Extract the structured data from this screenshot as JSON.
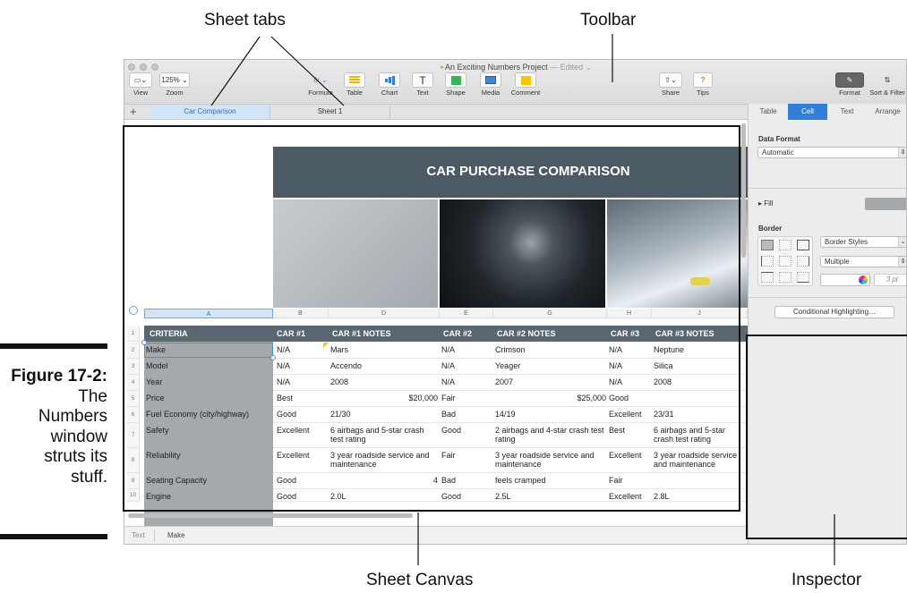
{
  "callouts": {
    "sheet_tabs": "Sheet tabs",
    "toolbar": "Toolbar",
    "sheet_canvas": "Sheet Canvas",
    "inspector": "Inspector"
  },
  "figure": {
    "number": "Figure 17-2:",
    "caption_lines": [
      "The",
      "Numbers",
      "window",
      "struts its",
      "stuff."
    ]
  },
  "window": {
    "title": "An Exciting Numbers Project",
    "edited": "— Edited ⌄"
  },
  "toolbar": {
    "view": "View",
    "zoom_value": "125% ⌄",
    "zoom": "Zoom",
    "formula": "Formula",
    "formula_icon": "fx ⌄",
    "table": "Table",
    "chart": "Chart",
    "text": "Text",
    "text_icon": "T",
    "shape": "Shape",
    "media": "Media",
    "comment": "Comment",
    "share": "Share",
    "tips": "Tips",
    "tips_icon": "?",
    "format": "Format",
    "sort_filter": "Sort & Filter"
  },
  "sheets": {
    "add": "+",
    "tabs": [
      "Car Comparison",
      "Sheet 1"
    ]
  },
  "inspector": {
    "tabs": [
      "Table",
      "Cell",
      "Text",
      "Arrange"
    ],
    "data_format_label": "Data Format",
    "data_format_value": "Automatic",
    "fill_label": "▸ Fill",
    "border_label": "Border",
    "border_styles": "Border Styles",
    "border_multiple": "Multiple",
    "border_width": "3 pt",
    "conditional_highlighting": "Conditional Highlighting…"
  },
  "status": {
    "format": "Text",
    "value": "Make"
  },
  "sheet": {
    "title": "CAR PURCHASE COMPARISON",
    "col_letters": [
      "A",
      "B",
      "D",
      "E",
      "G",
      "H",
      "J"
    ],
    "headers": [
      "CRITERIA",
      "CAR #1",
      "CAR #1 NOTES",
      "CAR #2",
      "CAR #2 NOTES",
      "CAR #3",
      "CAR #3 NOTES"
    ],
    "rows": [
      {
        "n": "2",
        "cells": [
          "Make",
          "N/A",
          "Mars",
          "N/A",
          "Crimson",
          "N/A",
          "Neptune"
        ]
      },
      {
        "n": "3",
        "cells": [
          "Model",
          "N/A",
          "Accendo",
          "N/A",
          "Yeager",
          "N/A",
          "Silica"
        ]
      },
      {
        "n": "4",
        "cells": [
          "Year",
          "N/A",
          "2008",
          "N/A",
          "2007",
          "N/A",
          "2008"
        ]
      },
      {
        "n": "5",
        "cells": [
          "Price",
          "Best",
          "$20,000",
          "Fair",
          "$25,000",
          "Good",
          ""
        ]
      },
      {
        "n": "6",
        "cells": [
          "Fuel Economy (city/highway)",
          "Good",
          "21/30",
          "Bad",
          "14/19",
          "Excellent",
          "23/31"
        ]
      },
      {
        "n": "7",
        "cells": [
          "Safety",
          "Excellent",
          "6 airbags and 5-star crash test rating",
          "Good",
          "2 airbags and 4-star crash test rating",
          "Best",
          "6 airbags and 5-star crash test rating"
        ]
      },
      {
        "n": "8",
        "cells": [
          "Reliability",
          "Excellent",
          "3 year roadside service and maintenance",
          "Fair",
          "3 year roadside service and maintenance",
          "Excellent",
          "3 year roadside service and maintenance"
        ]
      },
      {
        "n": "9",
        "cells": [
          "Seating Capacity",
          "Good",
          "4",
          "Bad",
          "feels cramped",
          "Fair",
          ""
        ]
      },
      {
        "n": "10",
        "cells": [
          "Engine",
          "Good",
          "2.0L",
          "Good",
          "2.5L",
          "Excellent",
          "2.8L"
        ]
      }
    ],
    "header_row_num": "1"
  },
  "colors": {
    "accent": "#2f7fd8",
    "banner": "#4c5a63",
    "header_row": "#5b6770",
    "criteria_col": "#a5a9ab"
  }
}
